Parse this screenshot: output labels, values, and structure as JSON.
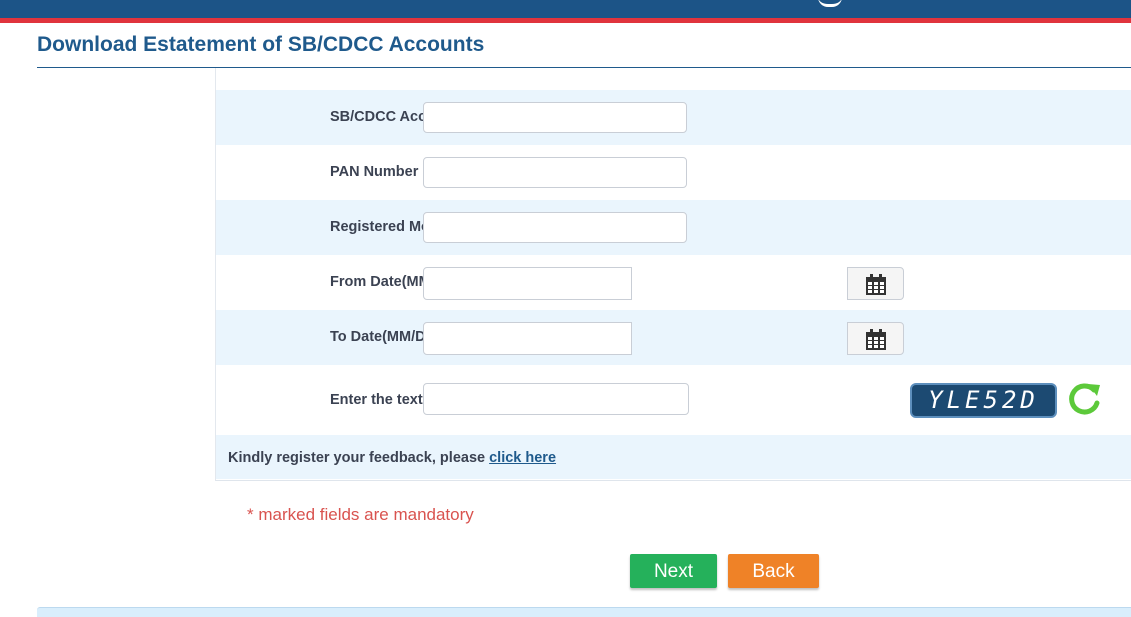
{
  "page": {
    "title": "Download Estatement of SB/CDCC Accounts"
  },
  "colors": {
    "header_bar": "#1c5487",
    "header_accent": "#e0343d",
    "title": "#1f5a8c",
    "row_shade": "#eaf5fd",
    "next_button": "#25b15b",
    "back_button": "#ef8227",
    "mandatory_text": "#d9534f"
  },
  "form": {
    "fields": [
      {
        "label": "SB/CDCC Account Number",
        "required_mark": "*",
        "value": "",
        "placeholder": ""
      },
      {
        "label": "PAN Number",
        "required_mark": "",
        "value": "",
        "placeholder": ""
      },
      {
        "label": "Registered Mobile Number",
        "required_mark": "*",
        "value": "",
        "placeholder": ""
      },
      {
        "label": "From Date(MM/DD/YYYY)",
        "required_mark": "",
        "value": "",
        "placeholder": "",
        "icon": "calendar-icon"
      },
      {
        "label": "To Date(MM/DD/YYYY)",
        "required_mark": "",
        "value": "",
        "placeholder": "",
        "icon": "calendar-icon"
      },
      {
        "label": "Enter the text as shown in image",
        "required_mark": "*",
        "value": "",
        "placeholder": ""
      }
    ],
    "captcha": {
      "text": "YLE52D",
      "refresh_icon": "refresh-icon"
    },
    "feedback": {
      "text": "Kindly register your feedback, please",
      "link_text": "click here"
    }
  },
  "mandatory_note": "* marked fields are mandatory",
  "buttons": {
    "next": "Next",
    "back": "Back"
  }
}
